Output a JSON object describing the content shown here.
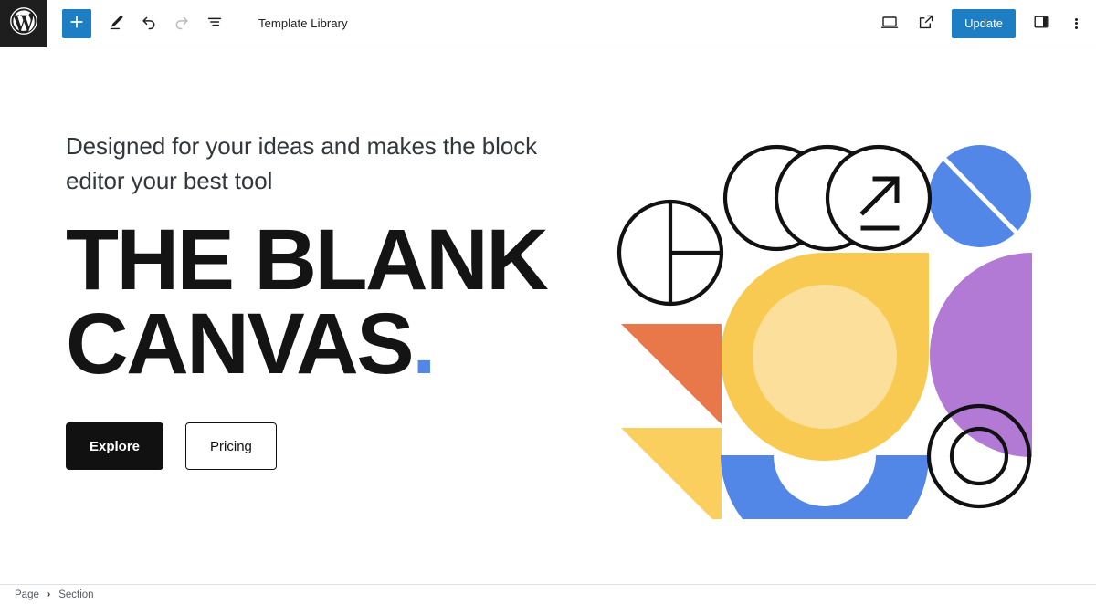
{
  "app": {
    "name": "WordPress Block Editor",
    "logo_icon": "wordpress-logo-icon"
  },
  "toolbar": {
    "add_block_label": "+",
    "add_block_icon": "plus-icon",
    "tools_icon": "pencil-icon",
    "undo_icon": "undo-arrow-icon",
    "redo_icon": "redo-arrow-icon",
    "list_view_icon": "list-view-icon",
    "document_title": "Template Library",
    "view_icon": "desktop-preview-icon",
    "external_preview_icon": "external-link-icon",
    "update_label": "Update",
    "settings_sidebar_icon": "sidebar-panel-icon",
    "options_icon": "kebab-menu-icon",
    "accent_color": "#1d7ec4"
  },
  "hero": {
    "lede": "Designed for your ideas and makes the block editor your best tool",
    "display_line1": "THE BLANK",
    "display_line2": "CANVAS",
    "display_dot": ".",
    "dot_color": "#5287e8",
    "primary_cta": "Explore",
    "secondary_cta": "Pricing"
  },
  "graphic": {
    "name": "abstract-geometric-collage",
    "colors": {
      "yellow": "#f9ca51",
      "light_yellow": "#fbdf9b",
      "blue": "#5287e8",
      "purple": "#b27ad4",
      "orange": "#e8784a",
      "soft_yellow": "#fbcf5e",
      "outline": "#111111"
    },
    "shapes": [
      "three-overlapping-outline-circles",
      "arrow-up-right-glyph",
      "blue-circle-with-diagonal-slash",
      "quartered-outline-circle",
      "orange-down-triangle",
      "yellow-down-triangle",
      "yellow-notched-circle",
      "light-yellow-inner-circle",
      "purple-half-circle",
      "blue-half-ring",
      "concentric-outline-rings"
    ]
  },
  "footer": {
    "breadcrumb": [
      {
        "label": "Page"
      },
      {
        "label": "Section"
      }
    ],
    "separator": "›"
  }
}
